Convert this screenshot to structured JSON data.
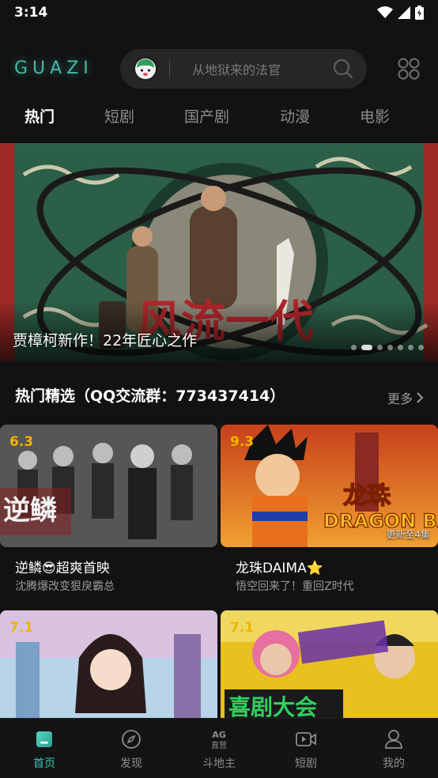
{
  "status_bar": {
    "time": "3:14"
  },
  "header": {
    "logo": "GUAZI",
    "search_placeholder": "从地狱来的法官"
  },
  "tabs": [
    {
      "label": "热门",
      "active": true
    },
    {
      "label": "短剧",
      "active": false
    },
    {
      "label": "国产剧",
      "active": false
    },
    {
      "label": "动漫",
      "active": false
    },
    {
      "label": "电影",
      "active": false
    }
  ],
  "banner": {
    "caption": "贾樟柯新作！22年匠心之作",
    "artwork_text": "风流一代",
    "slide_count": 8,
    "active_slide": 2
  },
  "section": {
    "title": "热门精选（QQ交流群：773437414）",
    "more": "更多"
  },
  "cards": [
    {
      "score": "6.3",
      "title": "逆鳞😎超爽首映",
      "subtitle": "沈腾爆改变狠戾霸总",
      "update": "",
      "art_text": "逆鳞"
    },
    {
      "score": "9.3",
      "title": "龙珠DAIMA⭐",
      "subtitle": "悟空回来了！重回Z时代",
      "update": "更新至4集",
      "art_text": "龙珠"
    },
    {
      "score": "7.1",
      "title": "",
      "subtitle": "",
      "update": "",
      "art_text": ""
    },
    {
      "score": "7.1",
      "title": "",
      "subtitle": "",
      "update": "",
      "art_text": "喜剧大会"
    }
  ],
  "bottom_nav": [
    {
      "label": "首页",
      "icon": "home-icon",
      "active": true
    },
    {
      "label": "发现",
      "icon": "compass-icon",
      "active": false
    },
    {
      "label": "斗地主",
      "icon": "ag-game-icon",
      "active": false
    },
    {
      "label": "短剧",
      "icon": "video-icon",
      "active": false
    },
    {
      "label": "我的",
      "icon": "user-icon",
      "active": false
    }
  ],
  "colors": {
    "accent": "#3fc2b0",
    "score": "#f0b400",
    "background": "#121212"
  }
}
